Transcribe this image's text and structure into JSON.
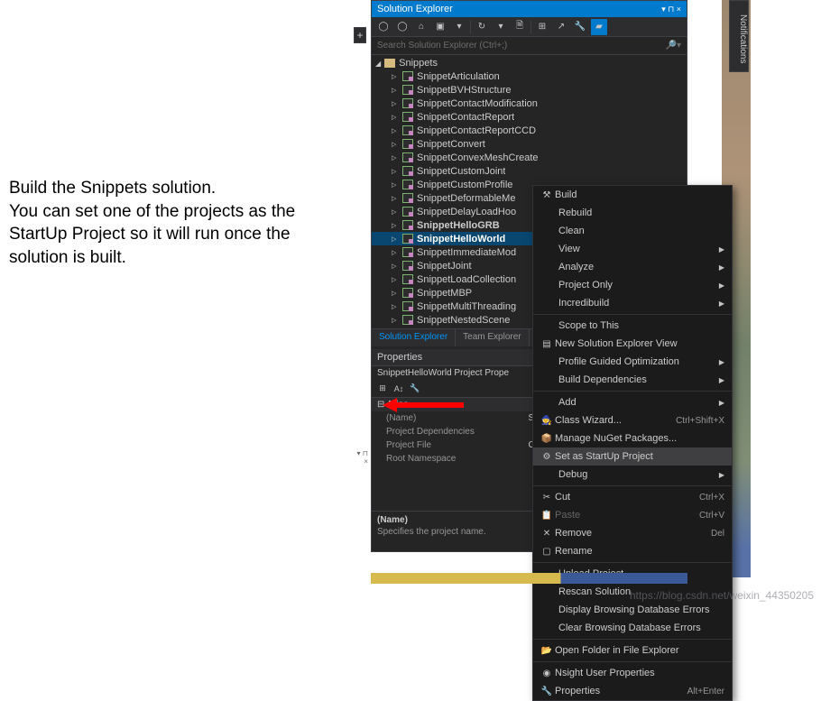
{
  "instruction": {
    "line1": "Build the Snippets solution.",
    "line2": "You can set one of the projects as the StartUp Project so it will run once the solution is built."
  },
  "notifications_label": "Notifications",
  "solution_explorer": {
    "title": "Solution Explorer",
    "search_placeholder": "Search Solution Explorer (Ctrl+;)",
    "root": "Snippets",
    "projects": [
      "SnippetArticulation",
      "SnippetBVHStructure",
      "SnippetContactModification",
      "SnippetContactReport",
      "SnippetContactReportCCD",
      "SnippetConvert",
      "SnippetConvexMeshCreate",
      "SnippetCustomJoint",
      "SnippetCustomProfile",
      "SnippetDeformableMe",
      "SnippetDelayLoadHoo",
      "SnippetHelloGRB",
      "SnippetHelloWorld",
      "SnippetImmediateMod",
      "SnippetJoint",
      "SnippetLoadCollection",
      "SnippetMBP",
      "SnippetMultiThreading",
      "SnippetNestedScene"
    ],
    "selected_index": 12,
    "bold_index": 11,
    "tabs": [
      "Solution Explorer",
      "Team Explorer"
    ]
  },
  "properties": {
    "header": "Properties",
    "subheader": "SnippetHelloWorld Project Prope",
    "category": "Misc",
    "rows": [
      {
        "key": "(Name)",
        "val": "Snip"
      },
      {
        "key": "Project Dependencies",
        "val": ""
      },
      {
        "key": "Project File",
        "val": "C:\\"
      },
      {
        "key": "Root Namespace",
        "val": ""
      }
    ],
    "desc_name": "(Name)",
    "desc_text": "Specifies the project name."
  },
  "context_menu": {
    "sections": [
      [
        {
          "label": "Build",
          "icon": "build"
        },
        {
          "label": "Rebuild"
        },
        {
          "label": "Clean"
        },
        {
          "label": "View",
          "submenu": true
        },
        {
          "label": "Analyze",
          "submenu": true
        },
        {
          "label": "Project Only",
          "submenu": true
        },
        {
          "label": "Incredibuild",
          "submenu": true
        }
      ],
      [
        {
          "label": "Scope to This"
        },
        {
          "label": "New Solution Explorer View",
          "icon": "new-view"
        },
        {
          "label": "Profile Guided Optimization",
          "submenu": true
        },
        {
          "label": "Build Dependencies",
          "submenu": true
        }
      ],
      [
        {
          "label": "Add",
          "submenu": true
        },
        {
          "label": "Class Wizard...",
          "icon": "wizard",
          "shortcut": "Ctrl+Shift+X"
        },
        {
          "label": "Manage NuGet Packages...",
          "icon": "nuget"
        },
        {
          "label": "Set as StartUp Project",
          "icon": "gear",
          "highlighted": true
        },
        {
          "label": "Debug",
          "submenu": true
        }
      ],
      [
        {
          "label": "Cut",
          "icon": "cut",
          "shortcut": "Ctrl+X"
        },
        {
          "label": "Paste",
          "icon": "paste",
          "shortcut": "Ctrl+V",
          "disabled": true
        },
        {
          "label": "Remove",
          "icon": "remove",
          "shortcut": "Del"
        },
        {
          "label": "Rename",
          "icon": "rename"
        }
      ],
      [
        {
          "label": "Unload Project"
        },
        {
          "label": "Rescan Solution"
        },
        {
          "label": "Display Browsing Database Errors"
        },
        {
          "label": "Clear Browsing Database Errors"
        }
      ],
      [
        {
          "label": "Open Folder in File Explorer",
          "icon": "folder"
        }
      ],
      [
        {
          "label": "Nsight User Properties",
          "icon": "nsight"
        },
        {
          "label": "Properties",
          "icon": "wrench",
          "shortcut": "Alt+Enter"
        }
      ]
    ]
  },
  "watermark": "https://blog.csdn.net/weixin_44350205"
}
